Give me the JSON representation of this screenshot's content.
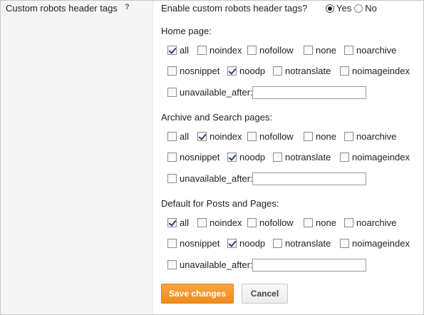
{
  "setting_title": "Custom robots header tags",
  "help_icon": {
    "icon": "help-icon",
    "text": "?"
  },
  "enable": {
    "label": "Enable custom robots header tags?",
    "options": [
      {
        "label": "Yes",
        "checked": true
      },
      {
        "label": "No",
        "checked": false
      }
    ]
  },
  "sections": [
    {
      "title": "Home page:",
      "row1": [
        {
          "label": "all",
          "checked": true
        },
        {
          "label": "noindex",
          "checked": false
        },
        {
          "label": "nofollow",
          "checked": false
        },
        {
          "label": "none",
          "checked": false
        },
        {
          "label": "noarchive",
          "checked": false
        }
      ],
      "row2": [
        {
          "label": "nosnippet",
          "checked": false
        },
        {
          "label": "noodp",
          "checked": true
        },
        {
          "label": "notranslate",
          "checked": false
        },
        {
          "label": "noimageindex",
          "checked": false
        }
      ],
      "unavailable": {
        "label": "unavailable_after:",
        "checked": false,
        "value": ""
      }
    },
    {
      "title": "Archive and Search pages:",
      "row1": [
        {
          "label": "all",
          "checked": false
        },
        {
          "label": "noindex",
          "checked": true
        },
        {
          "label": "nofollow",
          "checked": false
        },
        {
          "label": "none",
          "checked": false
        },
        {
          "label": "noarchive",
          "checked": false
        }
      ],
      "row2": [
        {
          "label": "nosnippet",
          "checked": false
        },
        {
          "label": "noodp",
          "checked": true
        },
        {
          "label": "notranslate",
          "checked": false
        },
        {
          "label": "noimageindex",
          "checked": false
        }
      ],
      "unavailable": {
        "label": "unavailable_after:",
        "checked": false,
        "value": ""
      }
    },
    {
      "title": "Default for Posts and Pages:",
      "row1": [
        {
          "label": "all",
          "checked": true
        },
        {
          "label": "noindex",
          "checked": false
        },
        {
          "label": "nofollow",
          "checked": false
        },
        {
          "label": "none",
          "checked": false
        },
        {
          "label": "noarchive",
          "checked": false
        }
      ],
      "row2": [
        {
          "label": "nosnippet",
          "checked": false
        },
        {
          "label": "noodp",
          "checked": true
        },
        {
          "label": "notranslate",
          "checked": false
        },
        {
          "label": "noimageindex",
          "checked": false
        }
      ],
      "unavailable": {
        "label": "unavailable_after:",
        "checked": false,
        "value": ""
      }
    }
  ],
  "buttons": {
    "save_label": "Save changes",
    "cancel_label": "Cancel"
  },
  "colors": {
    "save_bg": "#f39a2d",
    "help_link": "#2a5db0",
    "left_panel_bg": "#f5f5f5"
  }
}
